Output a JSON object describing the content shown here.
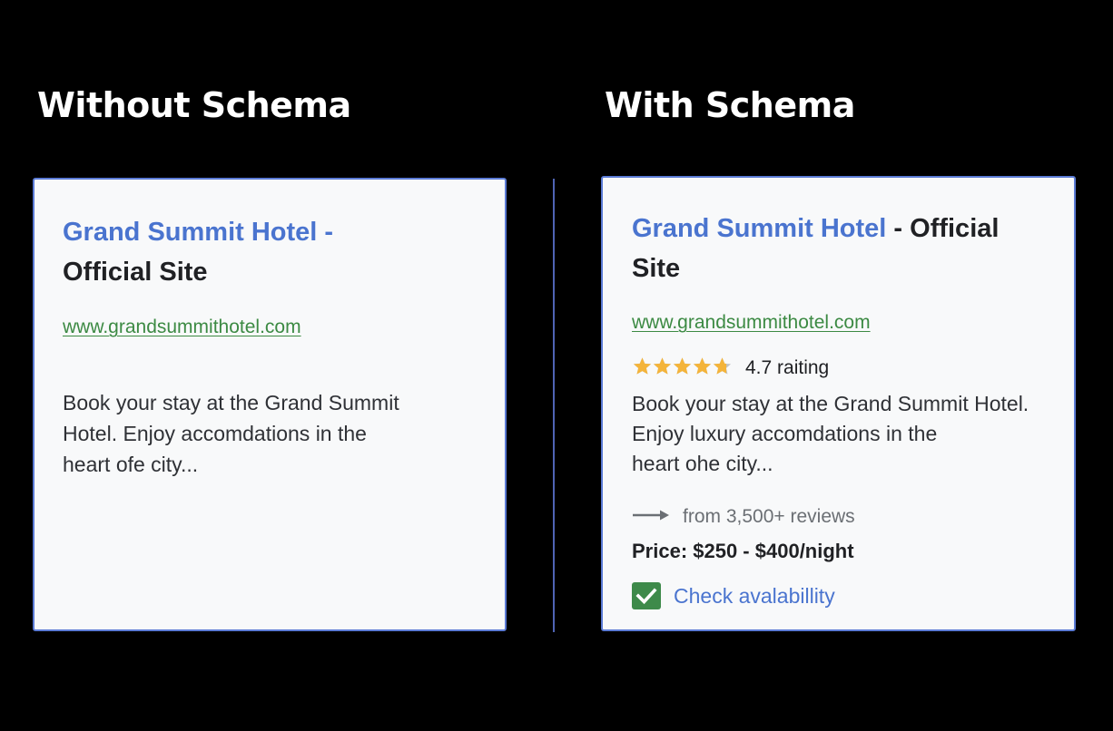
{
  "left_panel": {
    "heading": "Without Schema",
    "result": {
      "title_blue": "Grand Summit Hotel -",
      "title_dark": "Official Site",
      "url": "www.grandsummithotel.com",
      "description_lines": [
        "Book your stay at the Grand Summit",
        "Hotel. Enjoy accomdations in the",
        "heart ofe city..."
      ]
    }
  },
  "right_panel": {
    "heading": "With Schema",
    "result": {
      "title_blue": "Grand Summit Hotel",
      "title_dark_1": " - Official",
      "title_dark_2": "Site",
      "url": "www.grandsummithotel.com",
      "rating": {
        "value": 4.7,
        "max": 5,
        "star_color": "#f4b43a",
        "empty_star_color": "#bfc3c8",
        "text": "4.7 raiting"
      },
      "description_lines": [
        "Book your stay at the Grand Summit Hotel.",
        "Enjoy luxury accomdations in the",
        "heart ohe city..."
      ],
      "reviews_text": "from 3,500+ reviews",
      "reviews_icon": "arrow-right-icon",
      "price_text": "Price: $250 - $400/night",
      "availability": {
        "icon": "checkbox-checked-icon",
        "label": "Check avalabillity"
      }
    }
  },
  "colors": {
    "background": "#000000",
    "card_background": "#f8f9fa",
    "card_border": "#5b7bd5",
    "divider": "#4f64b4",
    "link_blue": "#4a74cf",
    "url_green": "#3c8a43",
    "check_green": "#3e8a4a"
  }
}
